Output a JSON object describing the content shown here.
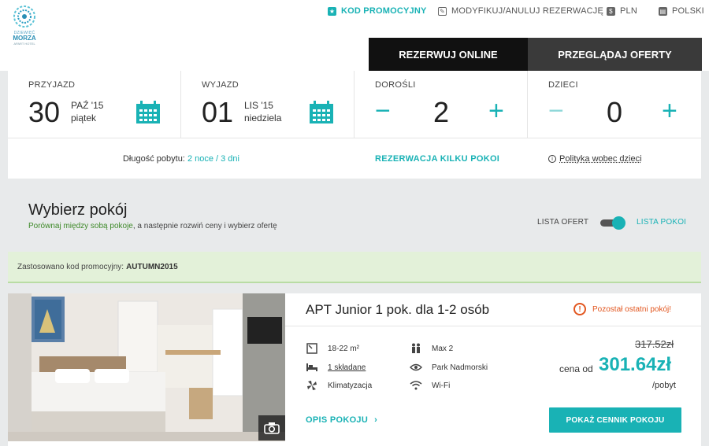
{
  "logo": {
    "line1": "DZIEWIĘĆ",
    "line2": "MORZA",
    "line3": "APART HOTEL"
  },
  "top_links": {
    "promo": "KOD PROMOCYJNY",
    "modify": "MODYFIKUJ/ANULUJ REZERWACJĘ",
    "currency": "PLN",
    "language": "POLSKI"
  },
  "tabs": {
    "book": "REZERWUJ ONLINE",
    "offers": "PRZEGLĄDAJ OFERTY"
  },
  "booking": {
    "arrival": {
      "label": "PRZYJAZD",
      "day": "30",
      "month": "PAŹ '15",
      "weekday": "piątek"
    },
    "departure": {
      "label": "WYJAZD",
      "day": "01",
      "month": "LIS '15",
      "weekday": "niedziela"
    },
    "adults": {
      "label": "DOROŚLI",
      "value": "2",
      "minus": "−",
      "plus": "+"
    },
    "children": {
      "label": "DZIECI",
      "value": "0",
      "minus": "−",
      "plus": "+"
    },
    "stay_label": "Długość pobytu:",
    "stay_value": "2 noce / 3 dni",
    "multi_rooms": "REZERWACJA KILKU POKOI",
    "child_policy": "Polityka wobec dzieci"
  },
  "choose": {
    "title": "Wybierz pokój",
    "subtitle_green": "Porównaj między sobą pokoje",
    "subtitle_rest": ", a następnie rozwiń ceny i wybierz ofertę",
    "toggle_left": "LISTA OFERT",
    "toggle_right": "LISTA POKOI"
  },
  "promo_applied": {
    "label": "Zastosowano kod promocyjny:",
    "code": "AUTUMN2015"
  },
  "room": {
    "title": "APT Junior 1 pok. dla 1-2 osób",
    "last_room": "Pozostał ostatni pokój!",
    "area": "18-22 m²",
    "bed": "1 składane",
    "aircon": "Klimatyzacja",
    "max": "Max 2",
    "view": "Park Nadmorski",
    "wifi": "Wi-Fi",
    "old_price": "317.52zł",
    "from_label": "cena od",
    "price": "301.64zł",
    "per": "/pobyt",
    "desc_link": "OPIS POKOJU",
    "price_button": "POKAŻ CENNIK POKOJU"
  },
  "colors": {
    "accent": "#19b2b5",
    "warning": "#e2561f",
    "promo_bg": "#e3f1d9"
  }
}
